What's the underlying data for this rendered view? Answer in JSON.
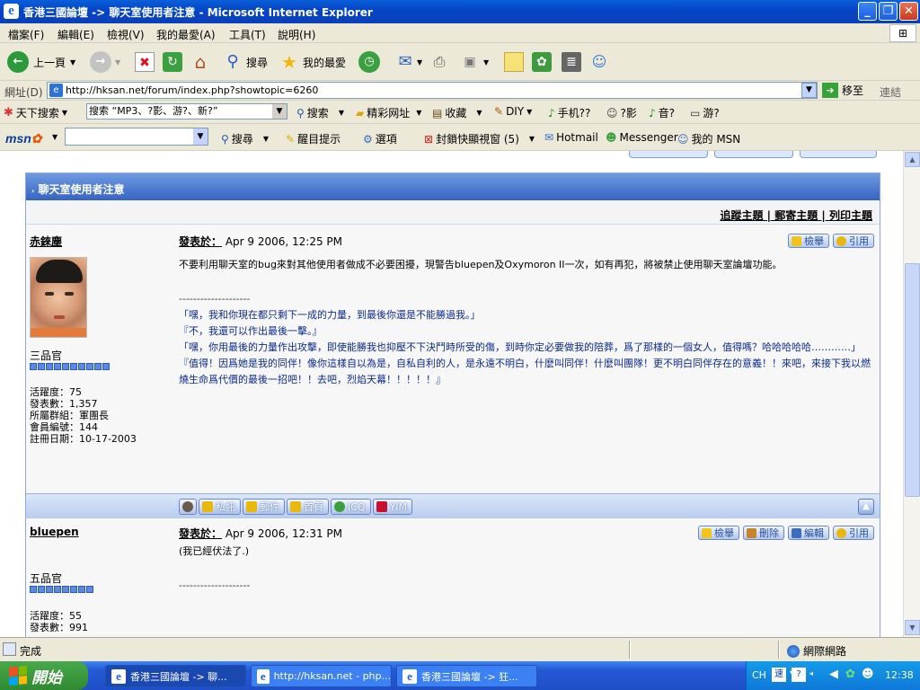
{
  "window": {
    "title": "香港三國論壇 -> 聊天室使用者注意 - Microsoft Internet Explorer",
    "controls": {
      "minimize": "_",
      "maximize": "❐",
      "close": "✕"
    }
  },
  "menu": [
    "檔案(F)",
    "編輯(E)",
    "檢視(V)",
    "我的最愛(A)",
    "工具(T)",
    "說明(H)"
  ],
  "toolbar": {
    "back": "上一頁",
    "search": "搜尋",
    "favorites": "我的最愛"
  },
  "address": {
    "label": "網址(D)",
    "url": "http://hksan.net/forum/index.php?showtopic=6260",
    "go": "移至",
    "links": "連結"
  },
  "search_toolbar": {
    "brand": "天下搜索",
    "query": "搜索 “MP3、?影、游?、新?”",
    "items": [
      "搜索",
      "精彩网址",
      "收藏",
      "DIY",
      "手机??",
      "?影",
      "音?",
      "游?"
    ]
  },
  "msn_toolbar": {
    "logo_main": "msn",
    "items": [
      "搜尋",
      "醒目提示",
      "選項",
      "封鎖快顯視窗 (5)",
      "Hotmail",
      "Messenger",
      "我的 MSN"
    ]
  },
  "forum": {
    "topic_title": "聊天室使用者注意",
    "topic_actions": [
      "追蹤主題",
      "郵寄主題",
      "列印主題"
    ],
    "posts": [
      {
        "username": "赤錸塵",
        "posted_label": "發表於：",
        "posted_time": "Apr 9 2006, 12:25 PM",
        "buttons": [
          "檢舉",
          "引用"
        ],
        "rank": "三品官",
        "stars": 10,
        "stats": [
          "活躍度：75",
          "發表數：1,357",
          "所屬群組：軍團長",
          "會員編號：144",
          "註冊日期：10-17-2003"
        ],
        "body": "不要利用聊天室的bug來對其他使用者做成不必要困擾，現警告bluepen及Oxymoron II一次，如有再犯，將被禁止使用聊天室論壇功能。",
        "separator": "--------------------",
        "quote_lines": [
          "「嘿，我和你現在都只剩下一成的力量，到最後你還是不能勝過我。」",
          "『不，我還可以作出最後一擊。』",
          "「嘿，你用最後的力量作出攻擊，即使能勝我也抑壓不下決鬥時所受的傷，到時你定必要做我的陪葬，爲了那樣的一個女人，值得嗎？哈哈哈哈哈…………」",
          "『值得！因爲她是我的同伴！像你這樣自以為是，自私自利的人，是永遠不明白，什麽叫同伴！什麽叫團隊！更不明白同伴存在的意義！！來吧，來接下我以燃燒生命爲代價的最後一招吧！！去吧，烈焰天幕！！！！！』"
        ],
        "sig_buttons": [
          "私訊",
          "郵件",
          "首頁",
          "ICQ",
          "YIM"
        ]
      },
      {
        "username": "bluepen",
        "posted_label": "發表於：",
        "posted_time": "Apr 9 2006, 12:31 PM",
        "buttons": [
          "檢舉",
          "刪除",
          "編輯",
          "引用"
        ],
        "rank": "五品官",
        "stars": 8,
        "stats": [
          "活躍度：55",
          "發表數：991"
        ],
        "body": "(我已經伏法了.)",
        "separator": "--------------------"
      }
    ]
  },
  "statusbar": {
    "status": "完成",
    "zone": "網際網路"
  },
  "taskbar": {
    "start": "開始",
    "tasks": [
      "香港三國論壇 -> 聊...",
      "http://hksan.net - php...",
      "香港三國論壇 -> 狂..."
    ],
    "tray": {
      "lang": "CH",
      "ime": "速",
      "help": "?",
      "clock": "12:38"
    }
  },
  "colors": {
    "title_bar": "#0a4fcf",
    "panel_header": "#3f6fcc",
    "quote_text": "#0b2b8f",
    "start_button": "#3a9a3c"
  }
}
